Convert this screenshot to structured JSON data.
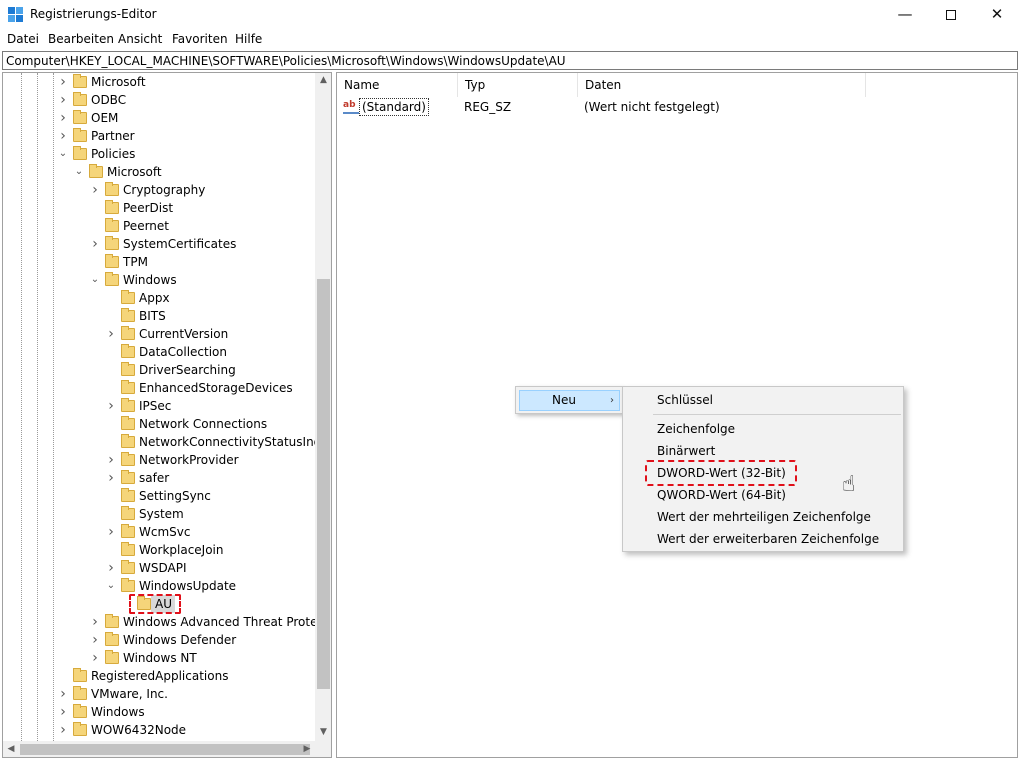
{
  "window": {
    "title": "Registrierungs-Editor",
    "minimize_glyph": "—",
    "close_glyph": "✕"
  },
  "menu": [
    "Datei",
    "Bearbeiten",
    "Ansicht",
    "Favoriten",
    "Hilfe"
  ],
  "address": "Computer\\HKEY_LOCAL_MACHINE\\SOFTWARE\\Policies\\Microsoft\\Windows\\WindowsUpdate\\AU",
  "tree": [
    {
      "label": "Microsoft",
      "level": 0,
      "expander": "collapsed"
    },
    {
      "label": "ODBC",
      "level": 0,
      "expander": "collapsed"
    },
    {
      "label": "OEM",
      "level": 0,
      "expander": "collapsed"
    },
    {
      "label": "Partner",
      "level": 0,
      "expander": "collapsed"
    },
    {
      "label": "Policies",
      "level": 0,
      "expander": "expanded"
    },
    {
      "label": "Microsoft",
      "level": 1,
      "expander": "expanded"
    },
    {
      "label": "Cryptography",
      "level": 2,
      "expander": "collapsed"
    },
    {
      "label": "PeerDist",
      "level": 2,
      "expander": "none"
    },
    {
      "label": "Peernet",
      "level": 2,
      "expander": "none"
    },
    {
      "label": "SystemCertificates",
      "level": 2,
      "expander": "collapsed"
    },
    {
      "label": "TPM",
      "level": 2,
      "expander": "none"
    },
    {
      "label": "Windows",
      "level": 2,
      "expander": "expanded"
    },
    {
      "label": "Appx",
      "level": 3,
      "expander": "none"
    },
    {
      "label": "BITS",
      "level": 3,
      "expander": "none"
    },
    {
      "label": "CurrentVersion",
      "level": 3,
      "expander": "collapsed"
    },
    {
      "label": "DataCollection",
      "level": 3,
      "expander": "none"
    },
    {
      "label": "DriverSearching",
      "level": 3,
      "expander": "none"
    },
    {
      "label": "EnhancedStorageDevices",
      "level": 3,
      "expander": "none"
    },
    {
      "label": "IPSec",
      "level": 3,
      "expander": "collapsed"
    },
    {
      "label": "Network Connections",
      "level": 3,
      "expander": "none"
    },
    {
      "label": "NetworkConnectivityStatusIndica",
      "level": 3,
      "expander": "none"
    },
    {
      "label": "NetworkProvider",
      "level": 3,
      "expander": "collapsed"
    },
    {
      "label": "safer",
      "level": 3,
      "expander": "collapsed"
    },
    {
      "label": "SettingSync",
      "level": 3,
      "expander": "none"
    },
    {
      "label": "System",
      "level": 3,
      "expander": "none"
    },
    {
      "label": "WcmSvc",
      "level": 3,
      "expander": "collapsed"
    },
    {
      "label": "WorkplaceJoin",
      "level": 3,
      "expander": "none"
    },
    {
      "label": "WSDAPI",
      "level": 3,
      "expander": "collapsed"
    },
    {
      "label": "WindowsUpdate",
      "level": 3,
      "expander": "expanded"
    },
    {
      "label": "AU",
      "level": 4,
      "expander": "none",
      "selected": true
    },
    {
      "label": "Windows Advanced Threat Protectio",
      "level": 2,
      "expander": "collapsed"
    },
    {
      "label": "Windows Defender",
      "level": 2,
      "expander": "collapsed"
    },
    {
      "label": "Windows NT",
      "level": 2,
      "expander": "collapsed"
    },
    {
      "label": "RegisteredApplications",
      "level": 0,
      "expander": "none"
    },
    {
      "label": "VMware, Inc.",
      "level": 0,
      "expander": "collapsed"
    },
    {
      "label": "Windows",
      "level": 0,
      "expander": "collapsed"
    },
    {
      "label": "WOW6432Node",
      "level": 0,
      "expander": "collapsed"
    }
  ],
  "values_pane": {
    "columns": [
      "Name",
      "Typ",
      "Daten"
    ],
    "rows": [
      {
        "name": "(Standard)",
        "type": "REG_SZ",
        "data": "(Wert nicht festgelegt)",
        "icon": "ab-string-icon"
      }
    ]
  },
  "context_menu": {
    "neu": "Neu",
    "submenu": [
      "Schlüssel",
      "Zeichenfolge",
      "Binärwert",
      "DWORD-Wert (32-Bit)",
      "QWORD-Wert (64-Bit)",
      "Wert der mehrteiligen Zeichenfolge",
      "Wert der erweiterbaren Zeichenfolge"
    ],
    "highlighted": "DWORD-Wert (32-Bit)"
  },
  "colors": {
    "highlight_red": "#e0101a",
    "menu_hover": "#cce8ff",
    "folder": "#f5d57a"
  }
}
